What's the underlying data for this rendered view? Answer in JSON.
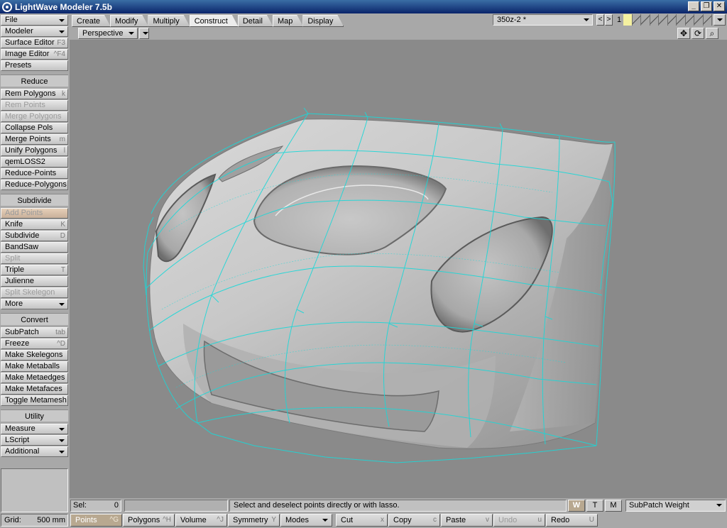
{
  "window": {
    "title": "LightWave Modeler 7.5b",
    "buttons": [
      "_",
      "❐",
      "✕"
    ]
  },
  "tabs": [
    {
      "label": "Create",
      "active": false
    },
    {
      "label": "Modify",
      "active": false
    },
    {
      "label": "Multiply",
      "active": false
    },
    {
      "label": "Construct",
      "active": true
    },
    {
      "label": "Detail",
      "active": false
    },
    {
      "label": "Map",
      "active": false
    },
    {
      "label": "Display",
      "active": false
    }
  ],
  "layer": {
    "object": "350z-2 *",
    "current": "1"
  },
  "viewport": {
    "mode": "Perspective"
  },
  "sidebar": {
    "top": [
      {
        "label": "File",
        "arrow": true
      },
      {
        "label": "Modeler",
        "arrow": true
      },
      {
        "label": "Surface Editor",
        "shortcut": "F3"
      },
      {
        "label": "Image Editor",
        "shortcut": "^F4"
      },
      {
        "label": "Presets"
      }
    ],
    "reduce": {
      "header": "Reduce",
      "items": [
        {
          "label": "Rem Polygons",
          "shortcut": "k"
        },
        {
          "label": "Rem Points",
          "disabled": true
        },
        {
          "label": "Merge Polygons",
          "disabled": true
        },
        {
          "label": "Collapse Pols"
        },
        {
          "label": "Merge Points",
          "shortcut": "m"
        },
        {
          "label": "Unify Polygons",
          "shortcut": "l"
        },
        {
          "label": "qemLOSS2"
        },
        {
          "label": "Reduce-Points"
        },
        {
          "label": "Reduce-Polygons"
        }
      ]
    },
    "subdivide": {
      "header": "Subdivide",
      "items": [
        {
          "label": "Add Points",
          "disabled": true,
          "highlight": true
        },
        {
          "label": "Knife",
          "shortcut": "K"
        },
        {
          "label": "Subdivide",
          "shortcut": "D"
        },
        {
          "label": "BandSaw"
        },
        {
          "label": "Split",
          "disabled": true
        },
        {
          "label": "Triple",
          "shortcut": "T"
        },
        {
          "label": "Julienne"
        },
        {
          "label": "Split Skelegon",
          "disabled": true
        },
        {
          "label": "More",
          "arrow": true
        }
      ]
    },
    "convert": {
      "header": "Convert",
      "items": [
        {
          "label": "SubPatch",
          "shortcut": "tab"
        },
        {
          "label": "Freeze",
          "shortcut": "^D"
        },
        {
          "label": "Make Skelegons"
        },
        {
          "label": "Make Metaballs"
        },
        {
          "label": "Make Metaedges"
        },
        {
          "label": "Make Metafaces"
        },
        {
          "label": "Toggle Metamesh"
        }
      ]
    },
    "utility": {
      "header": "Utility",
      "items": [
        {
          "label": "Measure",
          "arrow": true
        },
        {
          "label": "LScript",
          "arrow": true
        },
        {
          "label": "Additional",
          "arrow": true
        }
      ]
    }
  },
  "status": {
    "sel_label": "Sel:",
    "sel_count": "0",
    "hint": "Select and deselect points directly or with lasso.",
    "wtm": [
      "W",
      "T",
      "M"
    ],
    "map": "SubPatch Weight"
  },
  "bottom": {
    "grid_label": "Grid:",
    "grid_value": "500 mm",
    "buttons": [
      {
        "label": "Points",
        "shortcut": "^G",
        "active": true
      },
      {
        "label": "Polygons",
        "shortcut": "^H"
      },
      {
        "label": "Volume",
        "shortcut": "^J"
      },
      {
        "label": "Symmetry",
        "shortcut": "Y"
      },
      {
        "label": "Modes",
        "arrow": true
      },
      {
        "label": "Cut",
        "shortcut": "x"
      },
      {
        "label": "Copy",
        "shortcut": "c"
      },
      {
        "label": "Paste",
        "shortcut": "v"
      },
      {
        "label": "Undo",
        "shortcut": "u",
        "disabled": true
      },
      {
        "label": "Redo",
        "shortcut": "U"
      }
    ]
  },
  "colors": {
    "wire": "#19d8d8",
    "viewport_bg": "#8a8a8a",
    "active": "#b8a890"
  }
}
